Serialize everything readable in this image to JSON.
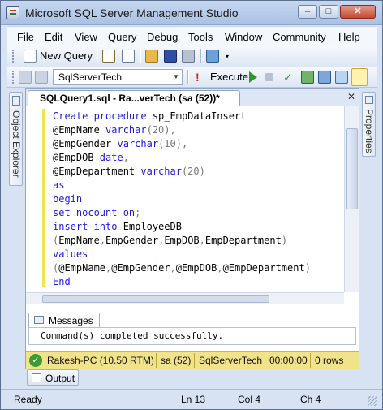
{
  "window": {
    "title": "Microsoft SQL Server Management Studio",
    "min": "–",
    "max": "□",
    "close": "✕"
  },
  "menu": [
    "File",
    "Edit",
    "View",
    "Query",
    "Debug",
    "Tools",
    "Window",
    "Community",
    "Help"
  ],
  "toolbar": {
    "new_query": "New Query",
    "database": "SqlServerTech",
    "execute": "Execute"
  },
  "side": {
    "object_explorer": "Object Explorer",
    "properties": "Properties"
  },
  "doc_tab": {
    "title": "SQLQuery1.sql - Ra...verTech (sa (52))*",
    "close": "✕"
  },
  "code": [
    {
      "parts": [
        {
          "t": "Create procedure ",
          "c": "kw"
        },
        {
          "t": "sp_EmpDataInsert",
          "c": ""
        }
      ]
    },
    {
      "parts": [
        {
          "t": "@EmpName ",
          "c": ""
        },
        {
          "t": "varchar",
          "c": "kw"
        },
        {
          "t": "(20),",
          "c": "gr"
        }
      ]
    },
    {
      "parts": [
        {
          "t": "@EmpGender ",
          "c": ""
        },
        {
          "t": "varchar",
          "c": "kw"
        },
        {
          "t": "(10),",
          "c": "gr"
        }
      ]
    },
    {
      "parts": [
        {
          "t": "@EmpDOB ",
          "c": ""
        },
        {
          "t": "date",
          "c": "kw"
        },
        {
          "t": ",",
          "c": "gr"
        }
      ]
    },
    {
      "parts": [
        {
          "t": "@EmpDepartment ",
          "c": ""
        },
        {
          "t": "varchar",
          "c": "kw"
        },
        {
          "t": "(20)",
          "c": "gr"
        }
      ]
    },
    {
      "parts": [
        {
          "t": "as",
          "c": "kw"
        }
      ]
    },
    {
      "parts": [
        {
          "t": "begin",
          "c": "kw"
        }
      ]
    },
    {
      "parts": [
        {
          "t": "set nocount on",
          "c": "kw"
        },
        {
          "t": ";",
          "c": "gr"
        }
      ]
    },
    {
      "parts": [
        {
          "t": "insert into ",
          "c": "kw"
        },
        {
          "t": "EmployeeDB",
          "c": ""
        }
      ]
    },
    {
      "parts": [
        {
          "t": "(",
          "c": "gr"
        },
        {
          "t": "EmpName",
          "c": ""
        },
        {
          "t": ",",
          "c": "gr"
        },
        {
          "t": "EmpGender",
          "c": ""
        },
        {
          "t": ",",
          "c": "gr"
        },
        {
          "t": "EmpDOB",
          "c": ""
        },
        {
          "t": ",",
          "c": "gr"
        },
        {
          "t": "EmpDepartment",
          "c": ""
        },
        {
          "t": ")",
          "c": "gr"
        }
      ]
    },
    {
      "parts": [
        {
          "t": "values",
          "c": "kw"
        }
      ]
    },
    {
      "parts": [
        {
          "t": "(",
          "c": "gr"
        },
        {
          "t": "@EmpName",
          "c": ""
        },
        {
          "t": ",",
          "c": "gr"
        },
        {
          "t": "@EmpGender",
          "c": ""
        },
        {
          "t": ",",
          "c": "gr"
        },
        {
          "t": "@EmpDOB",
          "c": ""
        },
        {
          "t": ",",
          "c": "gr"
        },
        {
          "t": "@EmpDepartment",
          "c": ""
        },
        {
          "t": ")",
          "c": "gr"
        }
      ]
    },
    {
      "parts": [
        {
          "t": "End",
          "c": "kw"
        }
      ]
    }
  ],
  "results": {
    "tab": "Messages",
    "message": "Command(s) completed successfully."
  },
  "query_status": {
    "server": "Rakesh-PC (10.50 RTM)",
    "user": "sa (52)",
    "database": "SqlServerTech",
    "time": "00:00:00",
    "rows": "0 rows"
  },
  "output_tab": "Output",
  "statusbar": {
    "state": "Ready",
    "ln": "Ln 13",
    "col": "Col 4",
    "ch": "Ch 4"
  },
  "colors": {
    "keyword": "#1a1adc",
    "status_bg": "#f1e38a",
    "chrome": "#d7e3f3"
  }
}
